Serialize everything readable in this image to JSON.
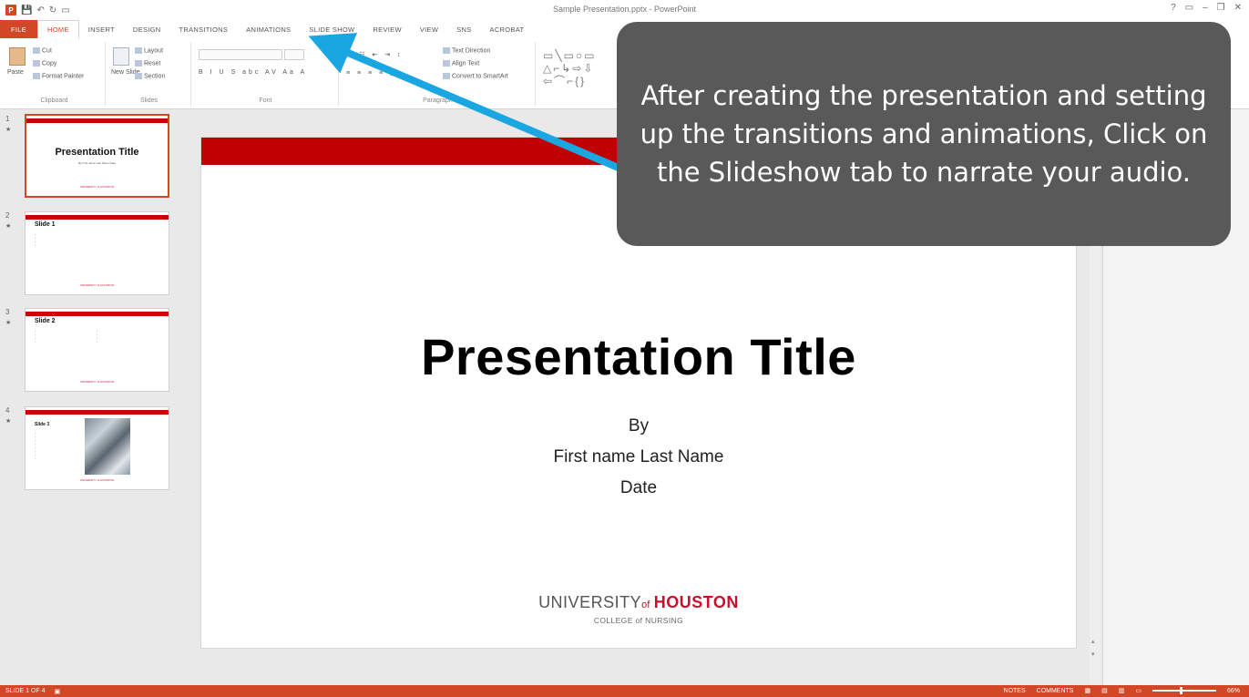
{
  "window": {
    "title": "Sample Presentation.pptx - PowerPoint",
    "controls": [
      "?",
      "▭",
      "–",
      "❐",
      "✕"
    ]
  },
  "tabs": [
    "FILE",
    "HOME",
    "INSERT",
    "DESIGN",
    "TRANSITIONS",
    "ANIMATIONS",
    "SLIDE SHOW",
    "REVIEW",
    "VIEW",
    "SNS",
    "ACROBAT"
  ],
  "active_tab": "HOME",
  "ribbon": {
    "clipboard": {
      "label": "Clipboard",
      "paste": "Paste",
      "cut": "Cut",
      "copy": "Copy",
      "format_painter": "Format Painter"
    },
    "slides": {
      "label": "Slides",
      "new_slide": "New Slide",
      "layout": "Layout",
      "reset": "Reset",
      "section": "Section"
    },
    "font": {
      "label": "Font"
    },
    "paragraph": {
      "label": "Paragraph",
      "text_direction": "Text Direction",
      "align_text": "Align Text",
      "convert": "Convert to SmartArt"
    }
  },
  "thumbnails": [
    {
      "num": "1",
      "title": "Presentation Title",
      "sub": "By First name Last Name Date"
    },
    {
      "num": "2",
      "title": "Slide 1"
    },
    {
      "num": "3",
      "title": "Slide 2"
    },
    {
      "num": "4",
      "title": "Slide 3"
    }
  ],
  "slide": {
    "title": "Presentation Title",
    "by": "By",
    "name": "First name Last Name",
    "date": "Date",
    "logo_university": "UNIVERSITY",
    "logo_of": "of",
    "logo_houston": "HOUSTON",
    "logo_college": "COLLEGE of NURSING"
  },
  "callout": {
    "text": "After creating the presentation and setting up the transitions and animations, Click on the Slideshow tab to narrate your audio."
  },
  "statusbar": {
    "slide": "SLIDE 1 OF 4",
    "notes": "NOTES",
    "comments": "COMMENTS",
    "zoom": "66%"
  },
  "colors": {
    "accent": "#d24726",
    "slide_bar": "#c00000",
    "callout_bg": "#595959",
    "arrow": "#1aa7e1",
    "houston_red": "#c8102e"
  }
}
